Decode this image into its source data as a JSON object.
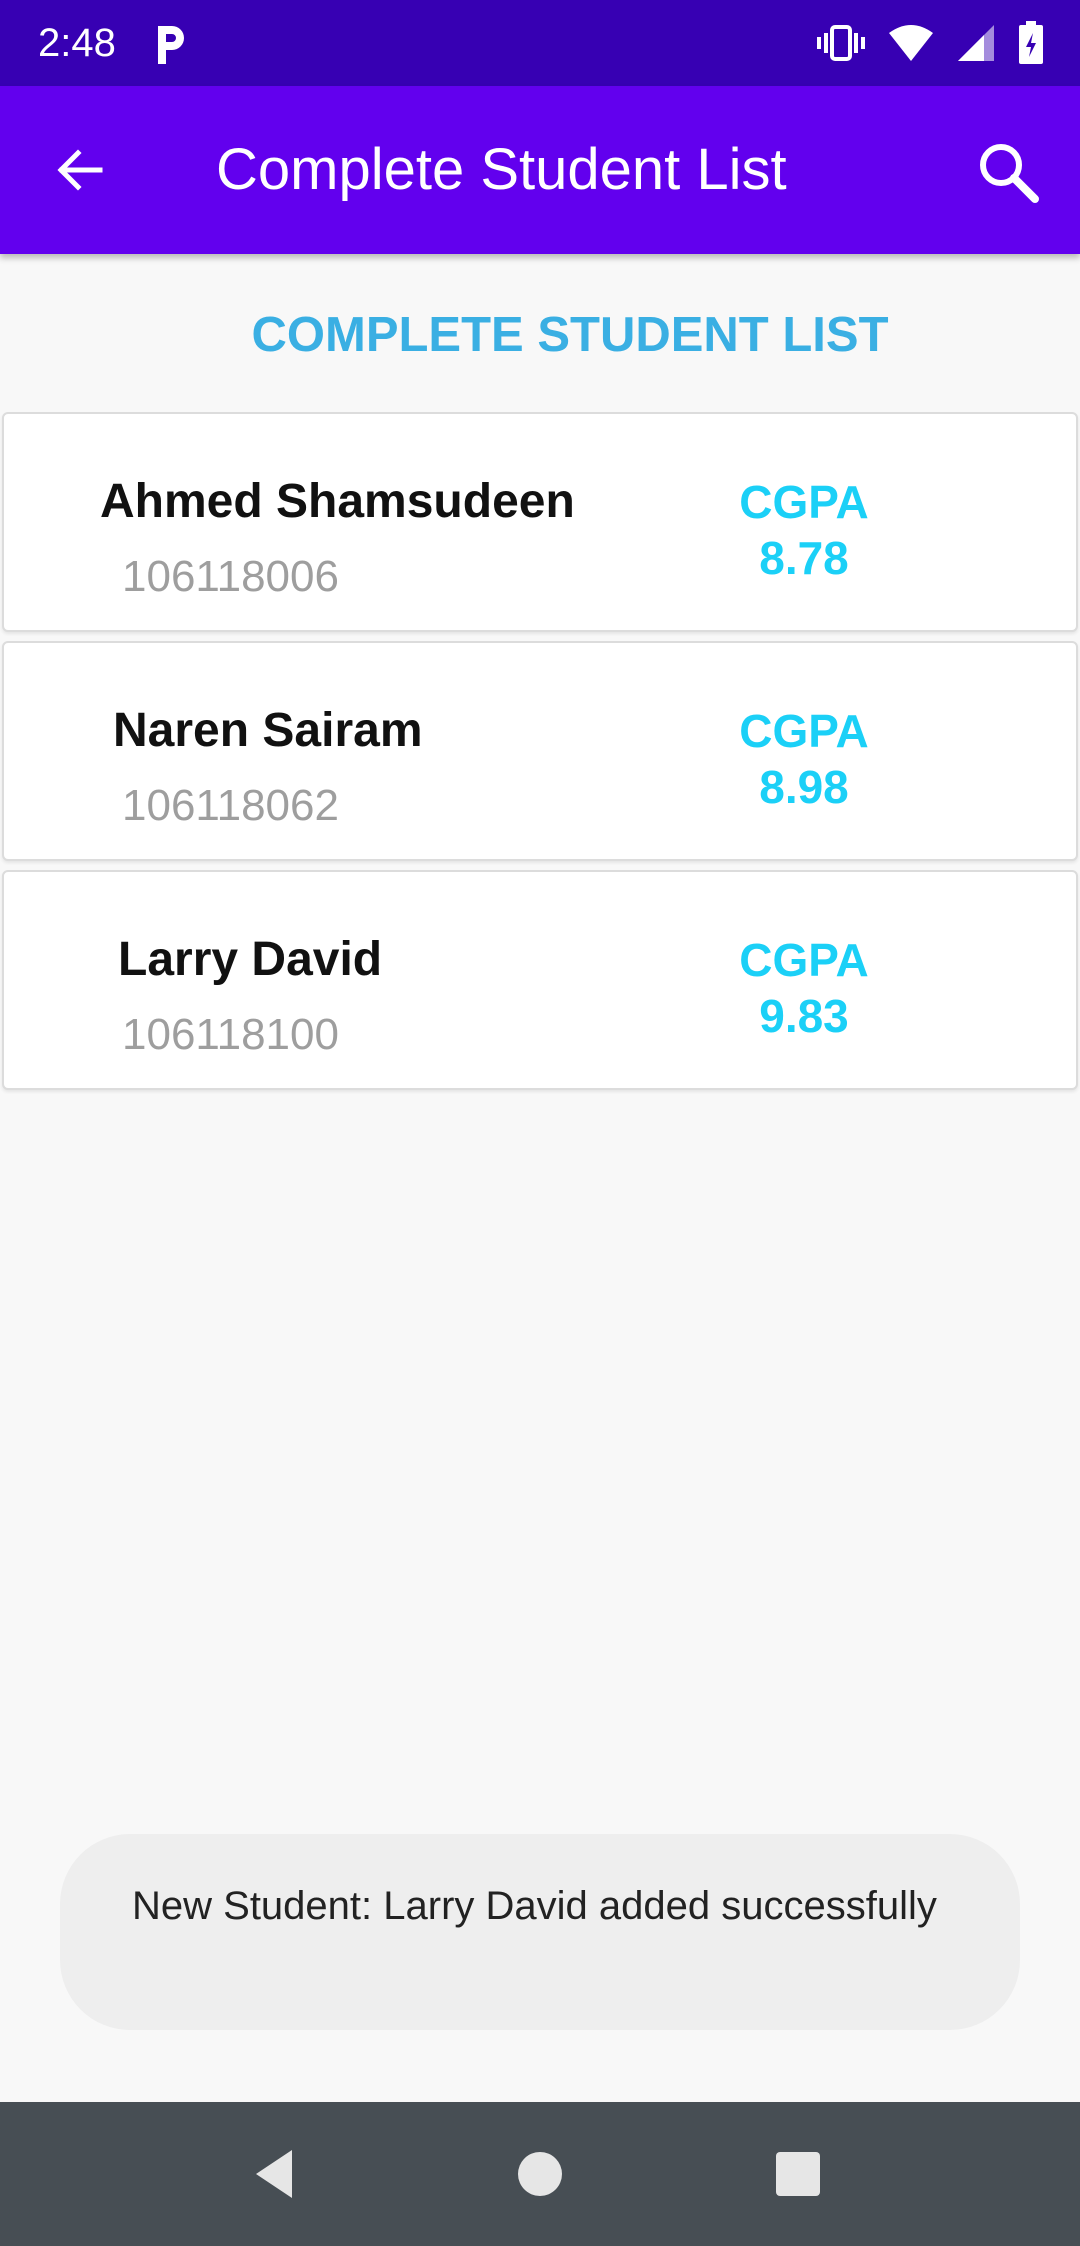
{
  "status_bar": {
    "time": "2:48",
    "left_icon": "parking-p-icon",
    "right_icons": [
      "vibrate-icon",
      "wifi-icon",
      "signal-icon",
      "battery-icon"
    ]
  },
  "app_bar": {
    "title": "Complete Student List",
    "back_icon": "arrow-back-icon",
    "search_icon": "search-icon"
  },
  "heading": "COMPLETE STUDENT LIST",
  "students": [
    {
      "name": "Ahmed Shamsudeen",
      "id": "106118006",
      "cgpa_label": "CGPA",
      "cgpa": "8.78"
    },
    {
      "name": "Naren Sairam",
      "id": "106118062",
      "cgpa_label": "CGPA",
      "cgpa": "8.98"
    },
    {
      "name": "Larry David",
      "id": "106118100",
      "cgpa_label": "CGPA",
      "cgpa": "9.83"
    }
  ],
  "toast": {
    "message": "New Student: Larry David added successfully"
  },
  "nav_bar": {
    "back_icon": "nav-back-icon",
    "home_icon": "nav-home-icon",
    "recents_icon": "nav-recents-icon"
  },
  "colors": {
    "status_bar": "#3700b3",
    "app_bar": "#6200ee",
    "heading": "#3aafe3",
    "cgpa": "#1bd0f7",
    "nav_bar": "#474e54"
  }
}
